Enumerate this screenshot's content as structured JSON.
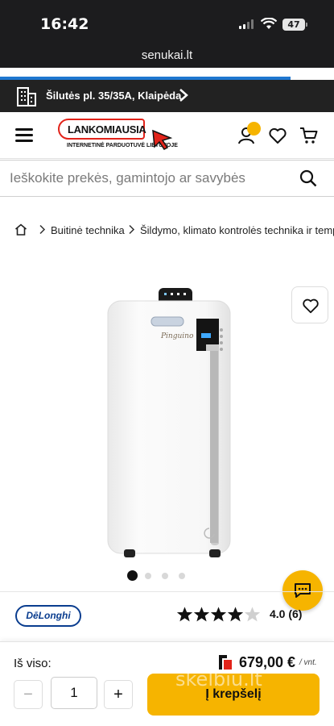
{
  "status_bar": {
    "time": "16:42",
    "battery": "47"
  },
  "browser": {
    "url": "senukai.lt",
    "load_progress": 0.87
  },
  "store": {
    "address": "Šilutės pl. 35/35A, Klaipėda"
  },
  "header": {
    "logo_name": "LANKOMIAUSIA",
    "logo_sub": "INTERNETINĖ PARDUOTUVĖ LIETUVOJE"
  },
  "search": {
    "placeholder": "Ieškokite prekės, gamintojo ar savybės"
  },
  "breadcrumb": [
    "Buitinė technika",
    "Šildymo, klimato kontrolės technika ir temp"
  ],
  "gallery": {
    "slides": 4,
    "active": 0
  },
  "brand": {
    "name": "DēLonghi"
  },
  "rating": {
    "score": 4.0,
    "display": "4.0 (6)",
    "stars_filled": 4,
    "stars_total": 5
  },
  "purchase": {
    "total_label": "Iš viso:",
    "price": "679,00 €",
    "unit": "/ vnt.",
    "quantity": "1",
    "minus": "−",
    "plus": "+",
    "add_to_cart": "Į krepšelį"
  },
  "watermark": "skelbiu.lt",
  "colors": {
    "accent": "#f6b400",
    "brand_red": "#e2231a",
    "delonghi_blue": "#0a3d8f",
    "dark_bar": "#222222"
  }
}
